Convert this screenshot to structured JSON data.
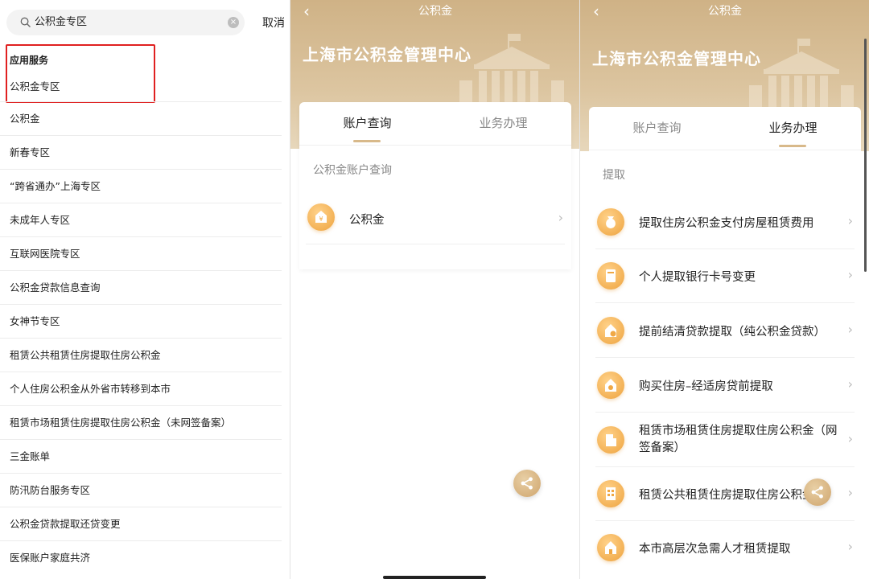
{
  "search": {
    "value": "公积金专区",
    "cancel": "取消"
  },
  "results": {
    "section_title": "应用服务",
    "top_item": "公积金专区",
    "items": [
      "公积金",
      "新春专区",
      "“跨省通办”上海专区",
      "未成年人专区",
      "互联网医院专区",
      "公积金贷款信息查询",
      "女神节专区",
      "租赁公共租赁住房提取住房公积金",
      "个人住房公积金从外省市转移到本市",
      "租赁市场租赁住房提取住房公积金（未网签备案）",
      "三金账单",
      "防汛防台服务专区",
      "公积金贷款提取还贷变更",
      "医保账户家庭共济"
    ]
  },
  "app": {
    "nav_title": "公积金",
    "hero_title": "上海市公积金管理中心",
    "tabs": [
      "账户查询",
      "业务办理"
    ]
  },
  "account_query": {
    "group_label": "公积金账户查询",
    "item": "公积金"
  },
  "business": {
    "group_label": "提取",
    "items": [
      "提取住房公积金支付房屋租赁费用",
      "个人提取银行卡号变更",
      "提前结清贷款提取（纯公积金贷款）",
      "购买住房–经适房贷前提取",
      "租赁市场租赁住房提取住房公积金（网签备案）",
      "租赁公共租赁住房提取住房公积金",
      "本市高层次急需人才租赁提取"
    ]
  },
  "colors": {
    "accent_gold": "#d8b98a",
    "icon_orange": "#f3b155",
    "highlight_red": "#e02020"
  }
}
